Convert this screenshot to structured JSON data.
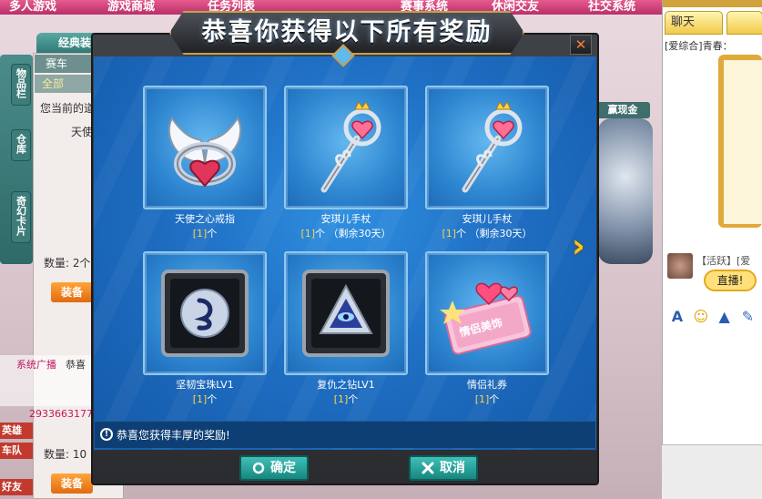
{
  "background": {
    "top_nav": [
      "多人游戏",
      "游戏商城",
      "任务列表",
      "赛事系统",
      "休闲交友",
      "社交系统"
    ],
    "side_tabs": [
      "物品栏",
      "仓库",
      "奇幻卡片"
    ],
    "shop_tab": "经典装",
    "category_header": "赛车",
    "category_all": "全部",
    "current_label": "您当前的道",
    "item_label": "天使",
    "qty_label_1": "数量: 2个",
    "qty_label_2": "数量: 10",
    "equip_label": "装备",
    "system_broadcast": "系统广播",
    "congrats_prefix": "恭喜",
    "qq_number": "2933663177",
    "cash_button": "赢现金",
    "red_labels": [
      "英雄",
      "车队",
      "好友"
    ]
  },
  "chat": {
    "tab_label": "聊天",
    "line": "[爱综合]青春：",
    "active_user": "【活跃】[爱",
    "live_badge": "直播!",
    "tools": [
      "font-icon",
      "smile-icon",
      "hat-icon",
      "edit-icon"
    ]
  },
  "modal": {
    "title": "恭喜你获得以下所有奖励",
    "close_glyph": "✕",
    "items": [
      {
        "name": "天使之心戒指",
        "qty": "[1]",
        "unit": "个",
        "extra": "",
        "icon": "ring-icon"
      },
      {
        "name": "安琪儿手杖",
        "qty": "[1]",
        "unit": "个",
        "extra": "（剩余30天）",
        "icon": "wand-icon"
      },
      {
        "name": "安琪儿手杖",
        "qty": "[1]",
        "unit": "个",
        "extra": "（剩余30天）",
        "icon": "wand-icon"
      },
      {
        "name": "坚韧宝珠LV1",
        "qty": "[1]",
        "unit": "个",
        "extra": "",
        "icon": "orb-icon"
      },
      {
        "name": "复仇之钻LV1",
        "qty": "[1]",
        "unit": "个",
        "extra": "",
        "icon": "diamond-icon"
      },
      {
        "name": "情侣礼券",
        "qty": "[1]",
        "unit": "个",
        "extra": "",
        "icon": "coupon-icon"
      }
    ],
    "coupon_text": "情侣美饰",
    "note": "恭喜您获得丰厚的奖励!",
    "confirm_label": "确定",
    "cancel_label": "取消"
  }
}
